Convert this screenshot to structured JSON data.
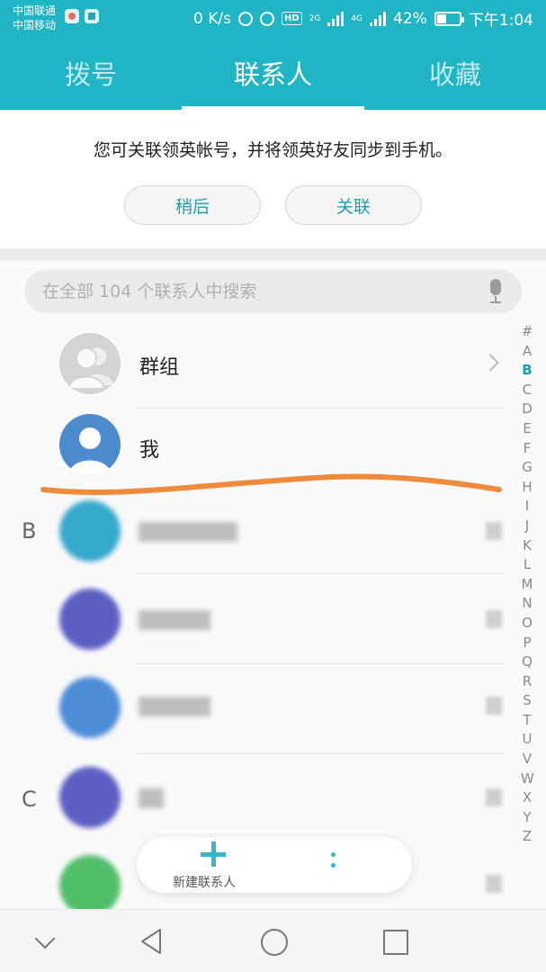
{
  "status_bar": {
    "carrier_1": "中国联通",
    "carrier_2": "中国移动",
    "net_speed": "0 K/s",
    "network_1": "2G",
    "network_2": "4G",
    "hd_badge": "HD",
    "battery_text": "42%",
    "battery_level": 0.42,
    "time": "下午1:04"
  },
  "tabs": [
    {
      "label": "拨号"
    },
    {
      "label": "联系人"
    },
    {
      "label": "收藏"
    }
  ],
  "active_tab": "联系人",
  "link_banner": {
    "text": "您可关联领英帐号，并将领英好友同步到手机。",
    "later_label": "稍后",
    "link_label": "关联"
  },
  "search": {
    "placeholder": "在全部 104 个联系人中搜索"
  },
  "list": {
    "group_label": "群组",
    "me_label": "我",
    "sections": [
      {
        "letter": "B"
      },
      {
        "letter": "C"
      }
    ]
  },
  "index_letters": [
    "#",
    "A",
    "B",
    "C",
    "D",
    "E",
    "F",
    "G",
    "H",
    "I",
    "J",
    "K",
    "L",
    "M",
    "N",
    "O",
    "P",
    "Q",
    "R",
    "S",
    "T",
    "U",
    "V",
    "W",
    "X",
    "Y",
    "Z"
  ],
  "index_current": "B",
  "fab": {
    "new_contact_label": "新建联系人"
  },
  "colors": {
    "accent": "#1fb5c4",
    "annotation_stroke": "#f08a3c"
  },
  "icons": [
    "mic-icon",
    "chevron-right-icon",
    "plus-icon",
    "more-vertical-icon",
    "nav-down-icon",
    "nav-back-icon",
    "nav-home-icon",
    "nav-recent-icon"
  ]
}
